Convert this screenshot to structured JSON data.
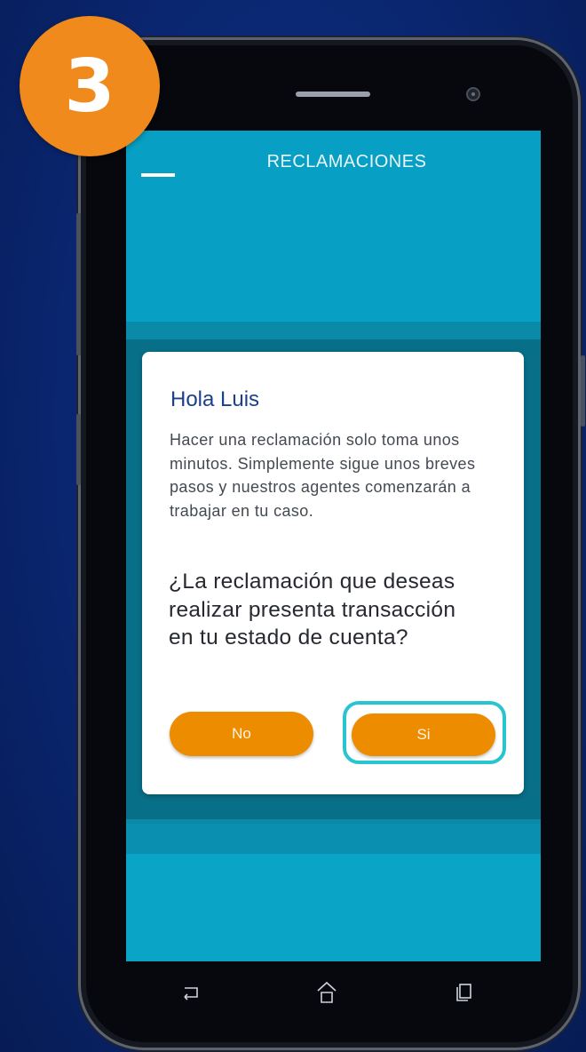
{
  "step_badge": "3",
  "app": {
    "title": "RECLAMACIONES"
  },
  "dialog": {
    "greeting": "Hola Luis",
    "intro": "Hacer una reclamación solo toma unos minutos. Simplemente sigue unos breves pasos y nuestros agentes comenzarán a trabajar en tu caso.",
    "question": "¿La reclamación que deseas realizar presenta transacción en tu estado de cuenta?",
    "buttons": {
      "no": "No",
      "yes": "Si"
    }
  },
  "nav_icons": [
    "back-icon",
    "home-icon",
    "recent-apps-icon"
  ],
  "colors": {
    "background": "#0a2670",
    "screen": "#0aa0c2",
    "button": "#ee8c00",
    "highlight": "#28c4cf",
    "badge": "#f08a1c",
    "greeting": "#1c3f8a"
  }
}
